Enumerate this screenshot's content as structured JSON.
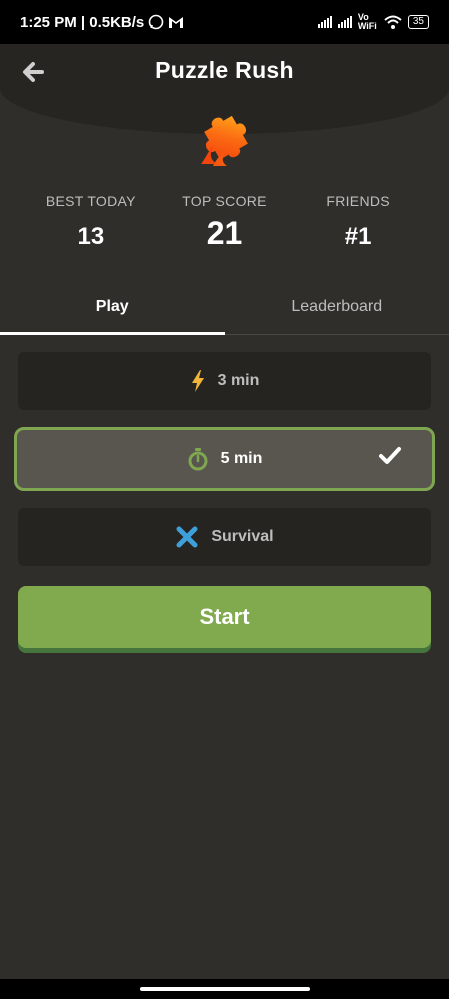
{
  "status_bar": {
    "time_speed": "1:25 PM | 0.5KB/s",
    "network_label": "Vo WiFi",
    "battery": "35"
  },
  "header": {
    "title": "Puzzle Rush"
  },
  "stats": [
    {
      "label": "BEST TODAY",
      "value": "13"
    },
    {
      "label": "TOP SCORE",
      "value": "21"
    },
    {
      "label": "FRIENDS",
      "value": "#1"
    }
  ],
  "tabs": [
    {
      "label": "Play",
      "active": true
    },
    {
      "label": "Leaderboard",
      "active": false
    }
  ],
  "modes": [
    {
      "label": "3 min",
      "icon": "lightning-icon",
      "color": "#f2b53b",
      "selected": false
    },
    {
      "label": "5 min",
      "icon": "stopwatch-icon",
      "color": "#7fa650",
      "selected": true
    },
    {
      "label": "Survival",
      "icon": "crossed-tools-icon",
      "color": "#3ea0d8",
      "selected": false
    }
  ],
  "start_button": {
    "label": "Start",
    "color": "#81a94d"
  }
}
